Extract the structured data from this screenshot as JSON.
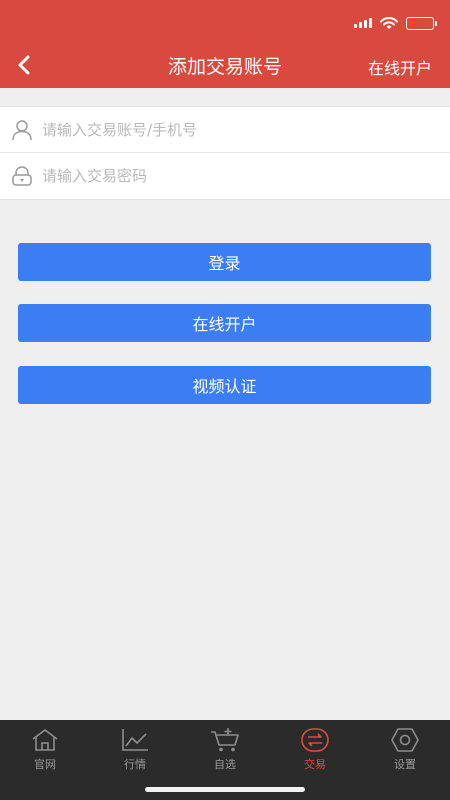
{
  "header": {
    "title": "添加交易账号",
    "action_label": "在线开户"
  },
  "status_bar": {
    "signal_bars": 4,
    "battery_level": 0.2
  },
  "form": {
    "account_placeholder": "请输入交易账号/手机号",
    "password_placeholder": "请输入交易密码"
  },
  "buttons": {
    "login": "登录",
    "open_account": "在线开户",
    "video_verify": "视频认证"
  },
  "tabs": [
    {
      "label": "官网",
      "icon": "home-icon"
    },
    {
      "label": "行情",
      "icon": "chart-icon"
    },
    {
      "label": "自选",
      "icon": "cart-icon"
    },
    {
      "label": "交易",
      "icon": "trade-icon",
      "active": true
    },
    {
      "label": "设置",
      "icon": "gear-icon"
    }
  ],
  "colors": {
    "header": "#d84a40",
    "button": "#3b7df2",
    "tabbar": "#2b2b2b",
    "active_tab": "#e14a41"
  }
}
